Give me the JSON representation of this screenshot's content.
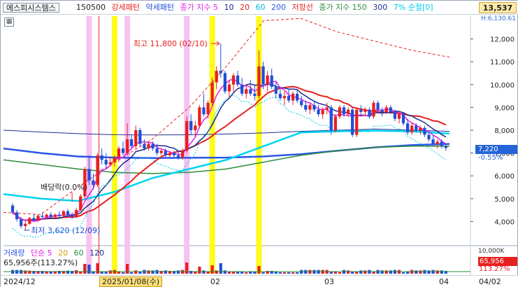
{
  "header": {
    "stock_name": "에스피시스템스",
    "code": "150500",
    "pattern_buy": "강세패턴",
    "pattern_sell": "약세패턴",
    "ma_label": "종가 지수 5",
    "ma_periods": [
      "10",
      "20",
      "60",
      "200"
    ],
    "resist_label": "저항선",
    "ma2_label": "종가 지수 150",
    "ma2_periods": [
      "300"
    ],
    "band_label": "7% 순절[0]",
    "price_box": "13,537",
    "price_sub": "H:6,130.61"
  },
  "colors": {
    "up": "#e81f1f",
    "down": "#1f4fd8",
    "ma5": "#e81fe8",
    "ma10": "#1a2a8a",
    "ma20": "#e81f1f",
    "ma60": "#00d4f0",
    "ma200": "#2a55e8",
    "ma150": "#2e8b3a",
    "ma300": "#1c2f90",
    "resist": "#e81f1f",
    "band": "#00c8e8",
    "pink_mark": "#f6c3f0",
    "yellow_mark": "#fffb1a"
  },
  "annotations": {
    "high": "최고 11,800 (02/10)",
    "low": "최저 3,620 (12/09)",
    "dividend": "배당락(0.0%)"
  },
  "volume": {
    "legend_label": "거래량",
    "ma_label": "단순 5",
    "ma_periods": [
      "20",
      "60",
      "120"
    ],
    "current": "65,956주(113.27%)",
    "badge": "65,956",
    "badge_pct": "113.27%",
    "axis_max": "10,000K"
  },
  "last": {
    "price": "7,220",
    "change_pct": "-0.55%"
  },
  "dates": {
    "d1": "2024/12",
    "highlight": "2025/01/08(수)",
    "d2": "02",
    "d3": "03",
    "d4": "04",
    "d5": "04/02"
  },
  "chart_data": {
    "type": "candlestick",
    "y_ticks": [
      4000,
      5000,
      6000,
      7000,
      8000,
      9000,
      10000,
      11000,
      12000
    ],
    "y_tick_labels": [
      "4,000",
      "5,000",
      "6,000",
      "7,000",
      "8,000",
      "9,000",
      "10,000",
      "11,000",
      "12,000"
    ],
    "ylim": [
      3000,
      13000
    ],
    "ohlc": [
      [
        4700,
        4800,
        4300,
        4400
      ],
      [
        4400,
        4500,
        4000,
        4100
      ],
      [
        4100,
        4200,
        3700,
        3800
      ],
      [
        3800,
        4000,
        3620,
        3900
      ],
      [
        3900,
        4200,
        3850,
        4150
      ],
      [
        4150,
        4300,
        4000,
        4050
      ],
      [
        4050,
        4300,
        4000,
        4250
      ],
      [
        4250,
        4400,
        4100,
        4200
      ],
      [
        4200,
        4350,
        4100,
        4300
      ],
      [
        4300,
        4400,
        4150,
        4200
      ],
      [
        4200,
        4350,
        4100,
        4300
      ],
      [
        4300,
        4450,
        4150,
        4250
      ],
      [
        4250,
        4500,
        4200,
        4450
      ],
      [
        4450,
        4550,
        4200,
        4300
      ],
      [
        4300,
        4400,
        4100,
        4200
      ],
      [
        4200,
        4600,
        4150,
        4500
      ],
      [
        4500,
        5200,
        4450,
        5100
      ],
      [
        5100,
        6400,
        5000,
        6300
      ],
      [
        6300,
        6900,
        5600,
        5800
      ],
      [
        5800,
        6100,
        5400,
        5600
      ],
      [
        5600,
        7000,
        5500,
        6900
      ],
      [
        6900,
        7200,
        6500,
        6700
      ],
      [
        6700,
        7000,
        6300,
        6500
      ],
      [
        6500,
        6800,
        6400,
        6600
      ],
      [
        6600,
        6900,
        6400,
        6800
      ],
      [
        6800,
        7300,
        6600,
        7200
      ],
      [
        7200,
        7500,
        6900,
        7000
      ],
      [
        7000,
        8300,
        6900,
        7600
      ],
      [
        7600,
        7800,
        7200,
        7300
      ],
      [
        7300,
        8200,
        7200,
        8000
      ],
      [
        8000,
        8100,
        7300,
        7400
      ],
      [
        7400,
        7600,
        7100,
        7200
      ],
      [
        7200,
        7500,
        7100,
        7400
      ],
      [
        7400,
        7500,
        7100,
        7200
      ],
      [
        7200,
        7400,
        6900,
        7000
      ],
      [
        7000,
        7200,
        6900,
        7100
      ],
      [
        7100,
        7200,
        6800,
        6900
      ],
      [
        6900,
        7100,
        6800,
        7000
      ],
      [
        7000,
        7100,
        6800,
        6900
      ],
      [
        6900,
        7100,
        6700,
        6800
      ],
      [
        6800,
        7200,
        6700,
        7100
      ],
      [
        7100,
        8600,
        7000,
        8400
      ],
      [
        8400,
        8700,
        7800,
        8000
      ],
      [
        8000,
        8400,
        7700,
        8200
      ],
      [
        8200,
        9100,
        8100,
        9000
      ],
      [
        9000,
        9600,
        8600,
        8700
      ],
      [
        8700,
        9300,
        8500,
        9200
      ],
      [
        9200,
        10300,
        9100,
        10100
      ],
      [
        10100,
        10800,
        9800,
        10600
      ],
      [
        10600,
        11800,
        10300,
        10500
      ],
      [
        10500,
        10600,
        9600,
        9700
      ],
      [
        9700,
        10200,
        9400,
        10000
      ],
      [
        10000,
        10500,
        9700,
        10400
      ],
      [
        10400,
        10600,
        9900,
        10000
      ],
      [
        10000,
        10300,
        9500,
        9600
      ],
      [
        9600,
        10000,
        9400,
        9800
      ],
      [
        9800,
        10200,
        9500,
        9600
      ],
      [
        9600,
        10000,
        9300,
        9500
      ],
      [
        9500,
        11500,
        9400,
        10800
      ],
      [
        10800,
        11000,
        9800,
        10000
      ],
      [
        10000,
        10600,
        9700,
        10400
      ],
      [
        10400,
        10700,
        9800,
        9900
      ],
      [
        9900,
        10100,
        9400,
        9600
      ],
      [
        9600,
        9900,
        9300,
        9400
      ],
      [
        9400,
        9700,
        9100,
        9500
      ],
      [
        9500,
        9800,
        9200,
        9300
      ],
      [
        9300,
        9700,
        9100,
        9600
      ],
      [
        9600,
        9800,
        9200,
        9300
      ],
      [
        9300,
        9500,
        9000,
        9100
      ],
      [
        9100,
        9300,
        8800,
        8900
      ],
      [
        8900,
        9200,
        8700,
        9100
      ],
      [
        9100,
        9300,
        8800,
        8900
      ],
      [
        8900,
        9100,
        8600,
        8700
      ],
      [
        8700,
        9000,
        8500,
        8900
      ],
      [
        8900,
        9200,
        8700,
        9000
      ],
      [
        9000,
        9100,
        7800,
        8000
      ],
      [
        8000,
        8700,
        7900,
        8600
      ],
      [
        8600,
        9100,
        8500,
        9000
      ],
      [
        9000,
        9100,
        8600,
        8700
      ],
      [
        8700,
        9000,
        8600,
        8900
      ],
      [
        8900,
        9000,
        7700,
        7800
      ],
      [
        7800,
        9000,
        7700,
        8900
      ],
      [
        8900,
        9100,
        8700,
        8800
      ],
      [
        8800,
        9000,
        8600,
        8900
      ],
      [
        8900,
        9000,
        8500,
        8600
      ],
      [
        8600,
        9300,
        8500,
        9200
      ],
      [
        9200,
        9300,
        8800,
        8900
      ],
      [
        8900,
        9000,
        8600,
        8800
      ],
      [
        8800,
        9100,
        8700,
        9000
      ],
      [
        9000,
        9100,
        8700,
        8800
      ],
      [
        8800,
        8900,
        8400,
        8500
      ],
      [
        8500,
        8800,
        8300,
        8700
      ],
      [
        8700,
        8800,
        8200,
        8300
      ],
      [
        8300,
        8500,
        7800,
        7900
      ],
      [
        7900,
        8300,
        7800,
        8200
      ],
      [
        8200,
        8300,
        7900,
        8000
      ],
      [
        8000,
        8200,
        7800,
        8100
      ],
      [
        8100,
        8200,
        7700,
        7800
      ],
      [
        7800,
        7900,
        7500,
        7600
      ],
      [
        7600,
        7800,
        7300,
        7400
      ],
      [
        7400,
        7600,
        7200,
        7500
      ],
      [
        7500,
        7600,
        7200,
        7300
      ],
      [
        7300,
        7400,
        7100,
        7220
      ]
    ]
  }
}
